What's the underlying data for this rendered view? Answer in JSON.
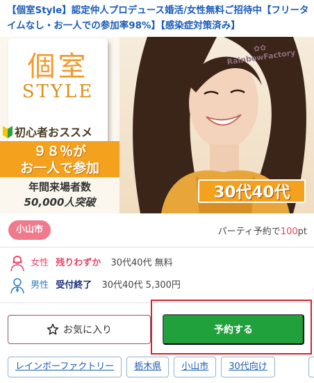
{
  "title": "【個室Style】認定仲人プロデュース婚活/女性無料ご招待中【フリータイムなし・お一人での参加率98%】【感染症対策済み】",
  "banner": {
    "logo_kanji": "個室",
    "logo_word": "STYLE",
    "beginner_text": "初心者おススメ",
    "rate_line1": "９８％が",
    "rate_line2": "お一人で参加",
    "visitors_line1": "年間来場者数",
    "visitors_line2": "50,000人突破",
    "brand": "RainbowFactory",
    "age_badge": "30代40代"
  },
  "city": "小山市",
  "points": {
    "prefix": "パーティ予約で",
    "value": "100",
    "unit": "pt"
  },
  "female": {
    "label": "女性",
    "status": "残りわずか",
    "detail": "30代40代 無料"
  },
  "male": {
    "label": "男性",
    "status": "受付終了",
    "detail": "30代40代 5,300円"
  },
  "buttons": {
    "favorite": "お気に入り",
    "reserve": "予約する"
  },
  "tags": [
    "レインボーファクトリー",
    "栃木県",
    "小山市",
    "30代向け"
  ],
  "colors": {
    "title_link": "#1a5cb8",
    "city_pill": "#f07a8c",
    "reserve_green": "#21a13b",
    "highlight_frame": "#d7202c",
    "banner_orange": "#f4a11d"
  }
}
